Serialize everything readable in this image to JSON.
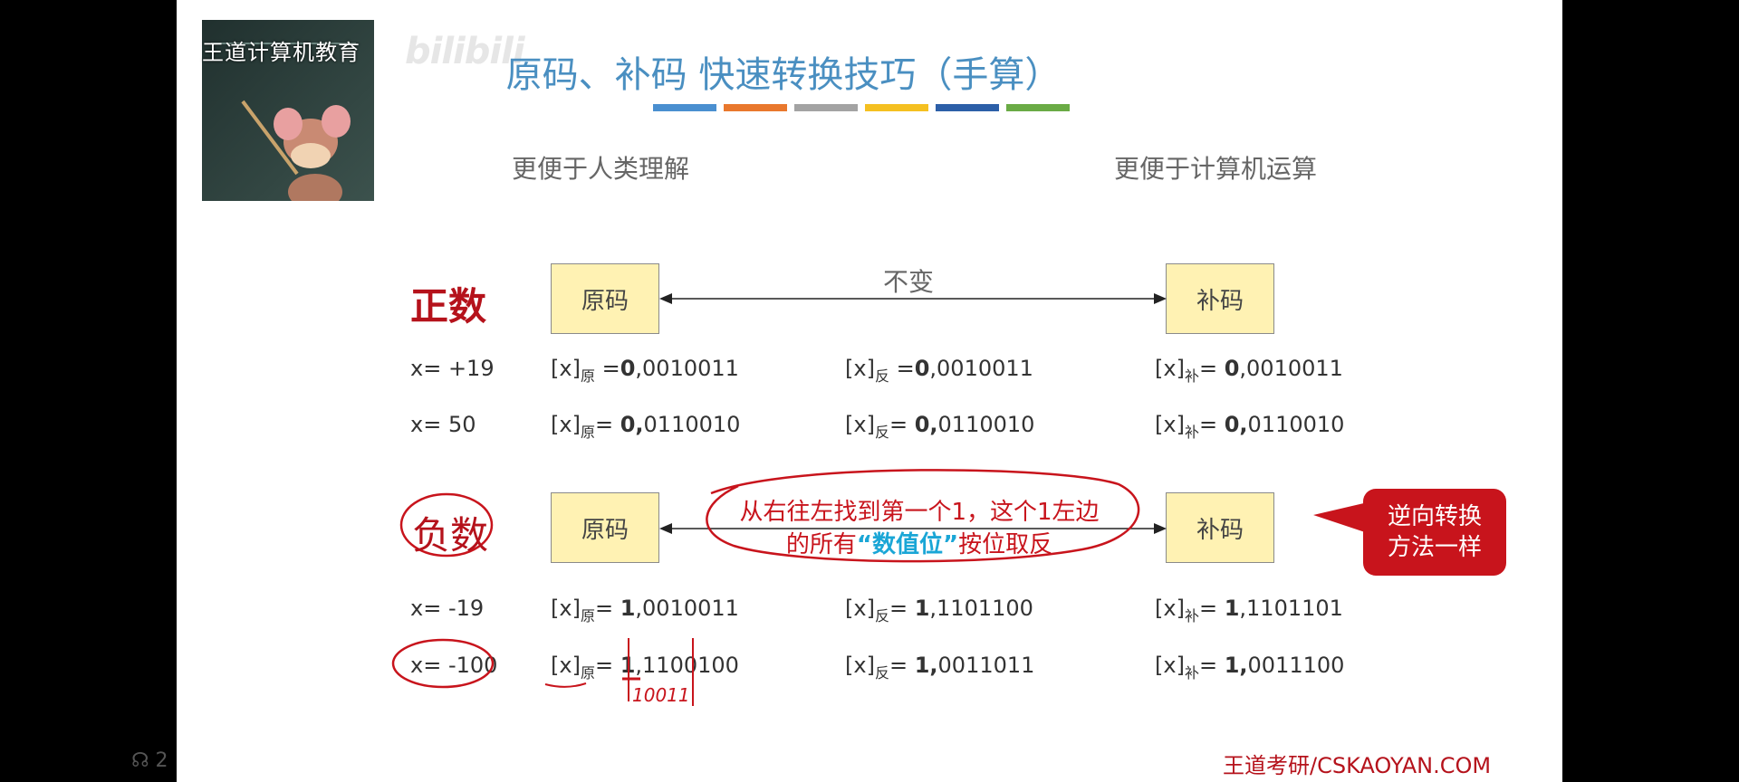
{
  "watermark": {
    "channel": "王道计算机教育",
    "brand": "bilibili"
  },
  "slide": {
    "title": "原码、补码 快速转换技巧（手算）",
    "accent_bars": [
      "#4a8fd0",
      "#e9782d",
      "#a3a3a3",
      "#f5c021",
      "#2c5fa8",
      "#6aab45"
    ],
    "left_caption": "更便于人类理解",
    "right_caption": "更便于计算机运算",
    "positive": {
      "label": "正数",
      "box_left": "原码",
      "box_right": "补码",
      "arrow_label": "不变",
      "rows": [
        {
          "x": "x= +19",
          "yuan_prefix": "[x]",
          "yuan_sub": "原",
          "yuan_eq": " =",
          "yuan_sign": "0",
          "yuan_rest": ",0010011",
          "fan_prefix": "[x]",
          "fan_sub": "反",
          "fan_eq": " =",
          "fan_sign": "0",
          "fan_rest": ",0010011",
          "bu_prefix": "[x]",
          "bu_sub": "补",
          "bu_eq": "= ",
          "bu_sign": "0",
          "bu_rest": ",0010011"
        },
        {
          "x": "x= 50",
          "yuan_prefix": "[x]",
          "yuan_sub": "原",
          "yuan_eq": "= ",
          "yuan_sign": "0,",
          "yuan_rest": "0110010",
          "fan_prefix": "[x]",
          "fan_sub": "反",
          "fan_eq": "= ",
          "fan_sign": "0,",
          "fan_rest": "0110010",
          "bu_prefix": "[x]",
          "bu_sub": "补",
          "bu_eq": "= ",
          "bu_sign": "0,",
          "bu_rest": "0110010"
        }
      ]
    },
    "negative": {
      "label": "负数",
      "box_left": "原码",
      "box_right": "补码",
      "rule_line1": "从右往左找到第一个1，这个1左边",
      "rule_line2_a": "的所有",
      "rule_line2_hl": "“数值位”",
      "rule_line2_b": "按位取反",
      "rows": [
        {
          "x": "x= -19",
          "yuan_prefix": "[x]",
          "yuan_sub": "原",
          "yuan_eq": "= ",
          "yuan_sign": "1",
          "yuan_rest": ",0010011",
          "fan_prefix": "[x]",
          "fan_sub": "反",
          "fan_eq": "= ",
          "fan_sign": "1",
          "fan_rest": ",1101100",
          "bu_prefix": "[x]",
          "bu_sub": "补",
          "bu_eq": "= ",
          "bu_sign": "1",
          "bu_rest": ",1101101"
        },
        {
          "x": "x= -100",
          "yuan_prefix": "[x]",
          "yuan_sub": "原",
          "yuan_eq": "= ",
          "yuan_sign": "1",
          "yuan_rest": ",1100100",
          "fan_prefix": "[x]",
          "fan_sub": "反",
          "fan_eq": "= ",
          "fan_sign": "1,",
          "fan_rest": "0011011",
          "bu_prefix": "[x]",
          "bu_sub": "补",
          "bu_eq": "= ",
          "bu_sign": "1,",
          "bu_rest": "0011100"
        }
      ],
      "handwritten_digits": "10011"
    },
    "callout": {
      "line1": "逆向转换",
      "line2": "方法一样"
    },
    "footer": "王道考研/CSKAOYAN.COM"
  },
  "player": {
    "corner_text": "2"
  }
}
